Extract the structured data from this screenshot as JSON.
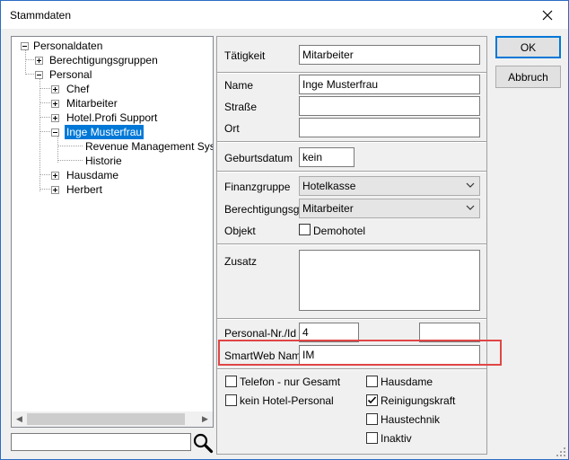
{
  "window": {
    "title": "Stammdaten"
  },
  "tree": {
    "nodes": {
      "personaldaten": "Personaldaten",
      "berechtigungsgruppen": "Berechtigungsgruppen",
      "personal": "Personal",
      "chef": "Chef",
      "mitarbeiter": "Mitarbeiter",
      "hotel_profi_support": "Hotel.Profi Support",
      "inge_musterfrau": "Inge Musterfrau",
      "revenue_management": "Revenue Management System",
      "historie": "Historie",
      "hausdame": "Hausdame",
      "herbert": "Herbert"
    },
    "search_value": ""
  },
  "form": {
    "taetigkeit": {
      "label": "Tätigkeit",
      "value": "Mitarbeiter"
    },
    "name": {
      "label": "Name",
      "value": "Inge Musterfrau"
    },
    "strasse": {
      "label": "Straße",
      "value": ""
    },
    "ort": {
      "label": "Ort",
      "value": ""
    },
    "geburtsdatum": {
      "label": "Geburtsdatum",
      "value": "kein"
    },
    "finanzgruppe": {
      "label": "Finanzgruppe",
      "value": "Hotelkasse"
    },
    "berechtigungsgruppe": {
      "label": "Berechtigungsgr.",
      "value": "Mitarbeiter"
    },
    "objekt": {
      "label": "Objekt",
      "checkbox_label": "Demohotel",
      "checked": false
    },
    "zusatz": {
      "label": "Zusatz",
      "value": ""
    },
    "personal_nr": {
      "label": "Personal-Nr./Id",
      "value": "4",
      "second_value": ""
    },
    "smartweb_name": {
      "label": "SmartWeb Name",
      "value": "IM"
    },
    "checkboxes": {
      "telefon_nur_gesamt": {
        "label": "Telefon - nur Gesamt",
        "checked": false
      },
      "kein_hotel_personal": {
        "label": "kein Hotel-Personal",
        "checked": false
      },
      "hausdame": {
        "label": "Hausdame",
        "checked": false
      },
      "reinigungskraft": {
        "label": "Reinigungskraft",
        "checked": true
      },
      "haustechnik": {
        "label": "Haustechnik",
        "checked": false
      },
      "inaktiv": {
        "label": "Inaktiv",
        "checked": false
      }
    }
  },
  "buttons": {
    "ok": "OK",
    "abbruch": "Abbruch"
  },
  "colors": {
    "selection": "#0078d7",
    "highlight_box": "#e04646",
    "default_button_border": "#0078d7"
  },
  "icons": [
    "close-icon",
    "search-icon",
    "chevron-down-icon",
    "checkmark-icon",
    "resize-grip-icon"
  ]
}
